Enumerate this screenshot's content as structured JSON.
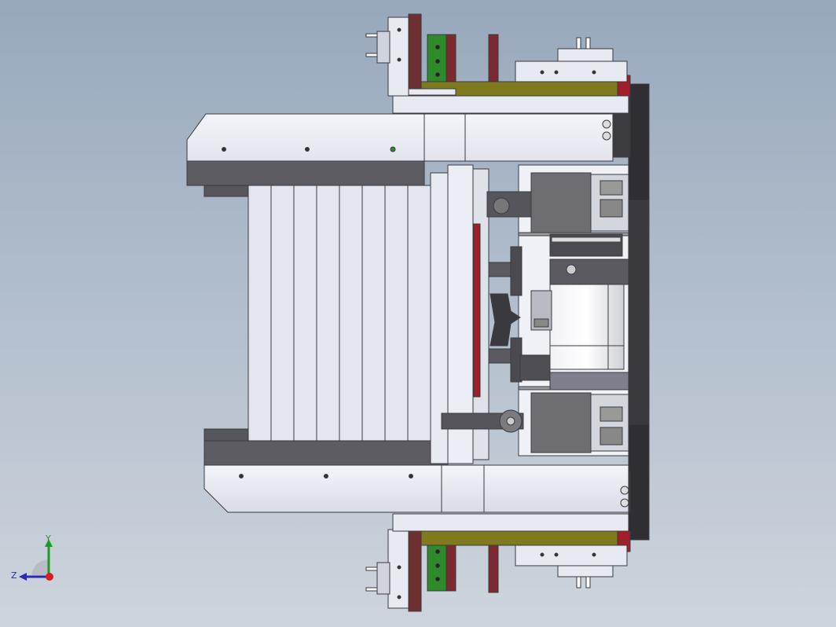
{
  "viewport": {
    "background_top": "#98a8bc",
    "background_bottom": "#cdd4dc",
    "model_colors": {
      "plate": "#e6e8f1",
      "plate_edge": "#4a4a52",
      "dark_steel": "#5c5c62",
      "charcoal": "#2d2d31",
      "brown": "#6e2a2a",
      "crimson": "#a01e28",
      "olive": "#7f7a1e",
      "green": "#2f8a2a",
      "motor_gray": "#6d6d72"
    }
  },
  "triad": {
    "y_label": "Y",
    "z_label": "Z",
    "y_color": "#1f9a2a",
    "z_color": "#2a2ab4",
    "x_color": "#d81e1e",
    "icons": [
      "axis-y-arrow-icon",
      "axis-z-arrow-icon",
      "axis-x-dot-icon"
    ]
  }
}
